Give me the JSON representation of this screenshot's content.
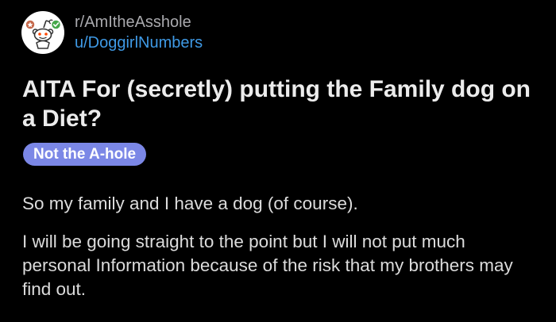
{
  "post": {
    "subreddit": "r/AmItheAsshole",
    "author": "u/DoggirlNumbers",
    "title": "AITA For (secretly) putting the Family dog on a Diet?",
    "flair": "Not the A-hole",
    "paragraphs": [
      "So my family and I have a dog (of course).",
      "I will be going straight to the point but I will not put much personal Information because of the risk that my brothers may find out."
    ]
  },
  "icons": {
    "avatar": "reddit-snoo-icon",
    "badge_left": "award-badge-icon",
    "badge_right": "verified-check-icon"
  },
  "colors": {
    "background": "#000000",
    "username": "#3f9ae6",
    "flair_bg": "#7b87e6"
  }
}
